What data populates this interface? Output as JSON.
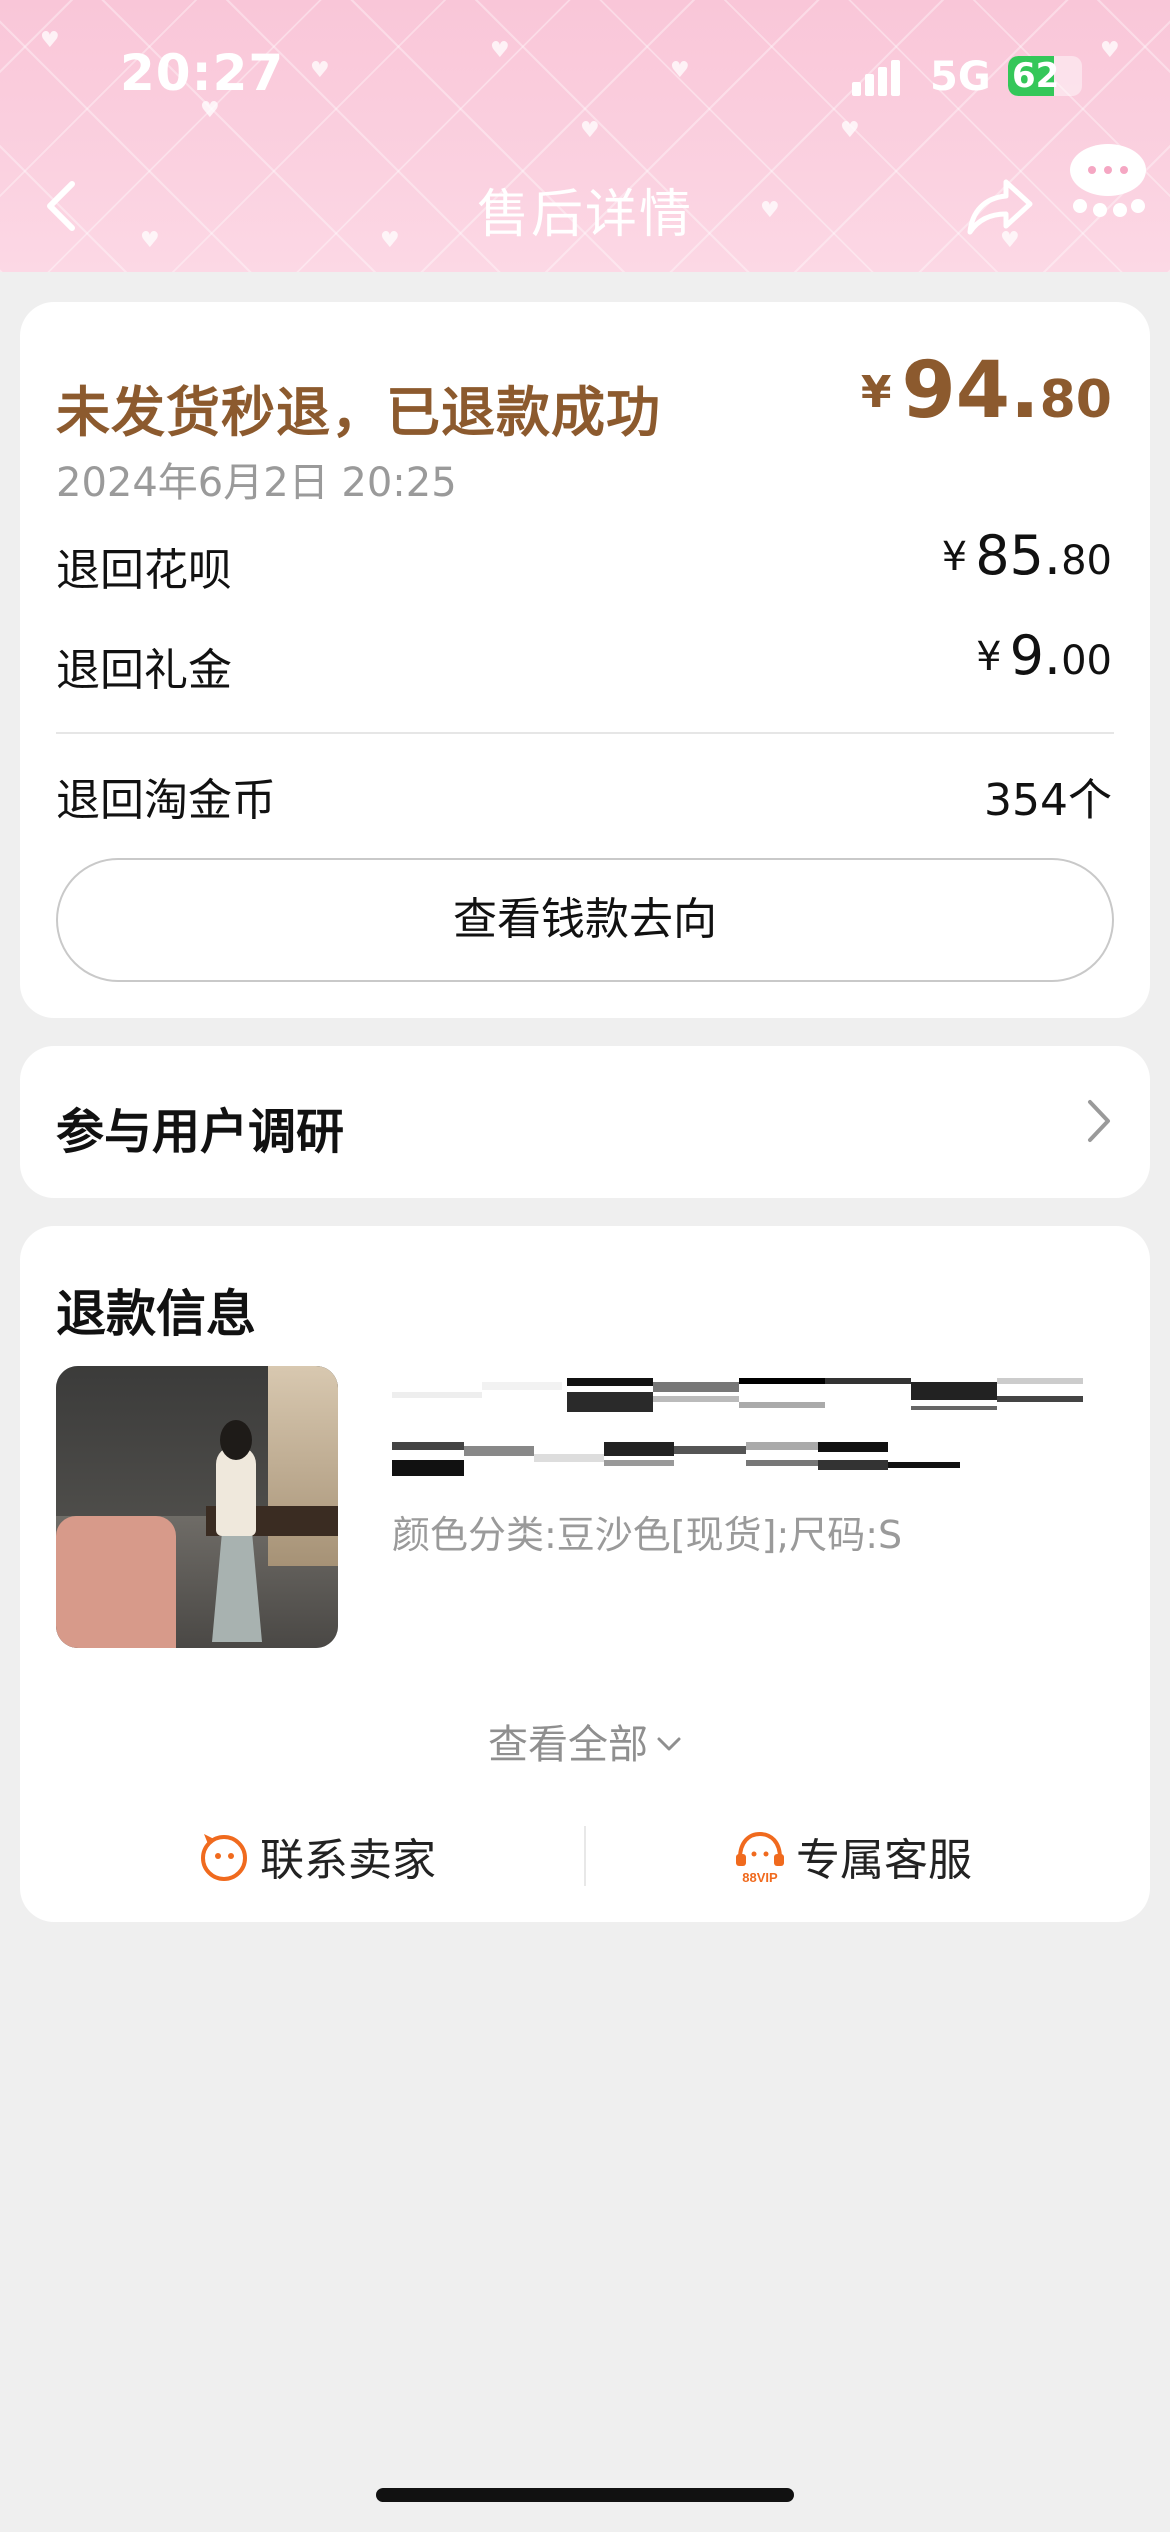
{
  "status_bar": {
    "time": "20:27",
    "network": "5G",
    "battery_percent": 62,
    "battery_label": "62"
  },
  "nav": {
    "title": "售后详情"
  },
  "refund_summary": {
    "title": "未发货秒退，已退款成功",
    "amount_currency": "¥",
    "amount_int": "94.",
    "amount_dec": "80",
    "date": "2024年6月2日 20:25",
    "rows": [
      {
        "label": "退回花呗",
        "currency": "¥",
        "int": "85.",
        "dec": "80"
      },
      {
        "label": "退回礼金",
        "currency": "¥",
        "int": "9.",
        "dec": "00"
      }
    ],
    "coin_label": "退回淘金币",
    "coin_value": "354个",
    "money_button": "查看钱款去向"
  },
  "survey": {
    "label": "参与用户调研"
  },
  "refund_info": {
    "title": "退款信息",
    "product_spec": "颜色分类:豆沙色[现货];尺码:S",
    "view_all": "查看全部",
    "contact_seller": "联系卖家",
    "exclusive_service": "专属客服",
    "service_badge": "88VIP"
  },
  "colors": {
    "accent_brown": "#8c5a2e",
    "icon_orange": "#f06a1e",
    "header_pink": "#fbcfdf",
    "battery_green": "#34c759"
  },
  "icons": {
    "back": "chevron-left-icon",
    "share": "share-icon",
    "more": "more-icon",
    "survey_chevron": "chevron-right-icon",
    "view_all": "chevron-down-icon",
    "seller": "seller-face-icon",
    "service": "headset-icon"
  }
}
